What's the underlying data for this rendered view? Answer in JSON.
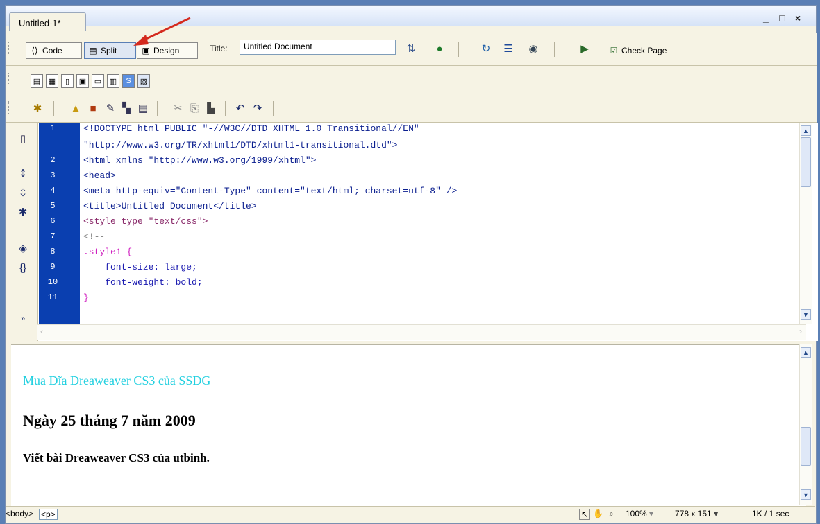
{
  "document": {
    "tab_label": "Untitled-1*",
    "window_controls": [
      "_",
      "□",
      "×"
    ]
  },
  "toolbar": {
    "code_label": "Code",
    "split_label": "Split",
    "design_label": "Design",
    "title_label": "Title:",
    "title_value": "Untitled Document",
    "check_page_label": "Check Page"
  },
  "code": {
    "lines": [
      {
        "num": "1",
        "text": "<!DOCTYPE html PUBLIC \"-//W3C//DTD XHTML 1.0 Transitional//EN\"",
        "color": "#0b1f8f"
      },
      {
        "num": "",
        "text": "\"http://www.w3.org/TR/xhtml1/DTD/xhtml1-transitional.dtd\">",
        "color": "#0b1f8f"
      },
      {
        "num": "2",
        "text": "<html xmlns=\"http://www.w3.org/1999/xhtml\">",
        "color": "#0b1f8f"
      },
      {
        "num": "3",
        "text": "<head>",
        "color": "#0b1f8f"
      },
      {
        "num": "4",
        "text": "<meta http-equiv=\"Content-Type\" content=\"text/html; charset=utf-8\" />",
        "color": "#0b1f8f"
      },
      {
        "num": "5",
        "text": "<title>Untitled Document</title>",
        "color": "#0b1f8f"
      },
      {
        "num": "6",
        "text": "<style type=\"text/css\">",
        "color": "#8a2a6a"
      },
      {
        "num": "7",
        "text": "<!--",
        "color": "#888888"
      },
      {
        "num": "8",
        "text": ".style1 {",
        "color": "#d020c0"
      },
      {
        "num": "9",
        "text": "    font-size: large;",
        "color": "#1a1ab0"
      },
      {
        "num": "10",
        "text": "    font-weight: bold;",
        "color": "#1a1ab0"
      },
      {
        "num": "11",
        "text": "}",
        "color": "#d020c0"
      }
    ]
  },
  "design_view": {
    "line1": "Mua Dĩa Dreaweaver CS3 của SSDG",
    "line1_color": "#22d0e0",
    "line2": "Ngày 25 tháng 7 năm 2009",
    "line3": "Viết bài Dreaweaver CS3 của utbinh."
  },
  "status_bar": {
    "tag_body": "<body>",
    "tag_p": "<p>",
    "zoom": "100%",
    "window_size": "778 x 151",
    "download": "1K / 1 sec"
  }
}
